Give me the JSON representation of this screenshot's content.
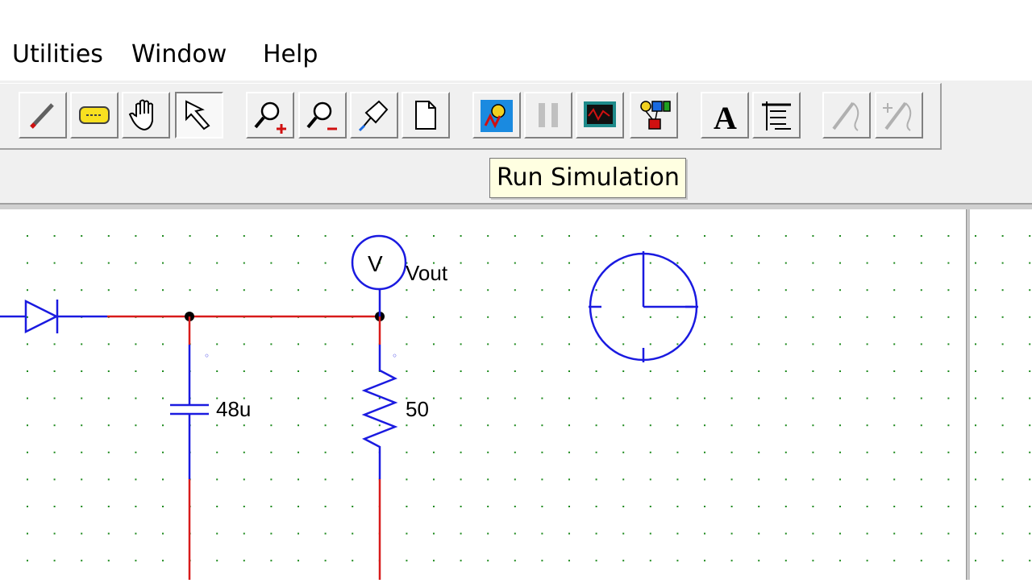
{
  "menu": {
    "items": [
      {
        "label": "Utilities"
      },
      {
        "label": "Window"
      },
      {
        "label": "Help"
      }
    ]
  },
  "toolbar": {
    "buttons": [
      {
        "name": "wire-tool-button",
        "icon": "pencil-icon"
      },
      {
        "name": "component-tool-button",
        "icon": "component-icon"
      },
      {
        "name": "pan-tool-button",
        "icon": "hand-icon"
      },
      {
        "name": "select-tool-button",
        "icon": "arrow-pointer-icon",
        "pressed": true
      },
      {
        "name": "zoom-in-button",
        "icon": "zoom-in-icon"
      },
      {
        "name": "zoom-out-button",
        "icon": "zoom-out-icon"
      },
      {
        "name": "probe-button",
        "icon": "probe-icon"
      },
      {
        "name": "new-page-button",
        "icon": "page-icon"
      },
      {
        "name": "run-simulation-button",
        "icon": "run-simulation-icon"
      },
      {
        "name": "pause-button",
        "icon": "pause-icon"
      },
      {
        "name": "scope-button",
        "icon": "oscilloscope-icon"
      },
      {
        "name": "block-diagram-button",
        "icon": "blocks-icon"
      },
      {
        "name": "text-button",
        "icon": "text-a-icon"
      },
      {
        "name": "list-button",
        "icon": "list-icon"
      },
      {
        "name": "disabled-tool-1-button",
        "icon": "disabled-probe-icon"
      },
      {
        "name": "disabled-tool-2-button",
        "icon": "disabled-add-probe-icon"
      }
    ]
  },
  "tooltip": {
    "text": "Run Simulation"
  },
  "schematic": {
    "capacitor_value": "48u",
    "resistor_value": "50",
    "voltmeter_symbol": "V",
    "voltmeter_label": "Vout"
  },
  "colors": {
    "wire_active": "#d81b1b",
    "wire_component": "#1a1ae0",
    "grid_dot": "#1e8a1e",
    "tooltip_bg": "#ffffe1"
  }
}
